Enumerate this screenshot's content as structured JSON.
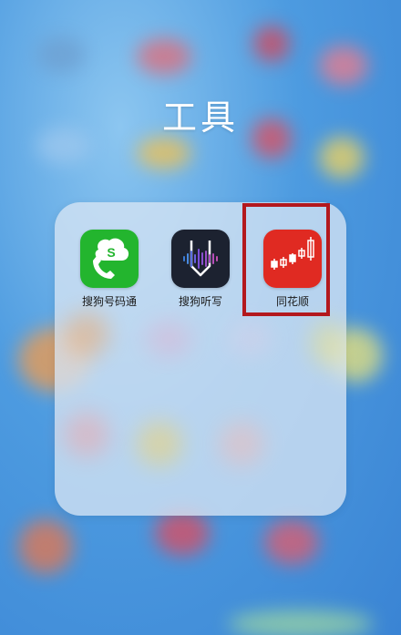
{
  "folder": {
    "title": "工具",
    "apps": [
      {
        "label": "搜狗号码通",
        "icon": "sogou-phone-icon",
        "color": "#23b52e"
      },
      {
        "label": "搜狗听写",
        "icon": "sogou-dictation-icon",
        "color": "#1c2230"
      },
      {
        "label": "同花顺",
        "icon": "tonghuashun-icon",
        "color": "#e02a22"
      }
    ]
  },
  "highlight": {
    "color": "#b3181d",
    "target": "同花顺"
  }
}
